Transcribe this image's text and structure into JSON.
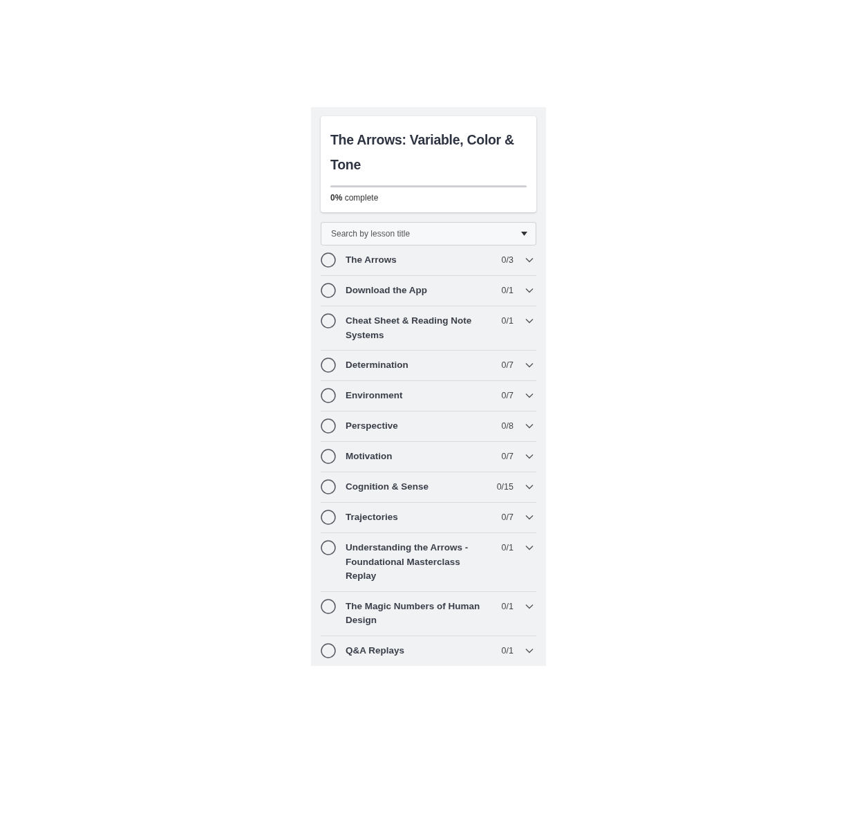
{
  "course": {
    "title": "The Arrows: Variable, Color & Tone",
    "progress": {
      "level": 0,
      "label": "**0%** complete"
    }
  },
  "search": {
    "placeholder": "Search by lesson title"
  },
  "sections": [
    {
      "title": "The Arrows",
      "count": "0/3",
      "completed": false
    },
    {
      "title": "Download the App",
      "count": "0/1",
      "completed": false
    },
    {
      "title": "Cheat Sheet & Reading Note Systems",
      "count": "0/1",
      "completed": false
    },
    {
      "title": "Determination",
      "count": "0/7",
      "completed": false
    },
    {
      "title": "Environment",
      "count": "0/7",
      "completed": false
    },
    {
      "title": "Perspective",
      "count": "0/8",
      "completed": false
    },
    {
      "title": "Motivation",
      "count": "0/7",
      "completed": false
    },
    {
      "title": "Cognition & Sense",
      "count": "0/15",
      "completed": false
    },
    {
      "title": "Trajectories",
      "count": "0/7",
      "completed": false
    },
    {
      "title": "Understanding the Arrows - Foundational Masterclass Replay",
      "count": "0/1",
      "completed": false
    },
    {
      "title": "The Magic Numbers of Human Design",
      "count": "0/1",
      "completed": false
    },
    {
      "title": "Q&A Replays",
      "count": "0/1",
      "completed": false
    }
  ]
}
